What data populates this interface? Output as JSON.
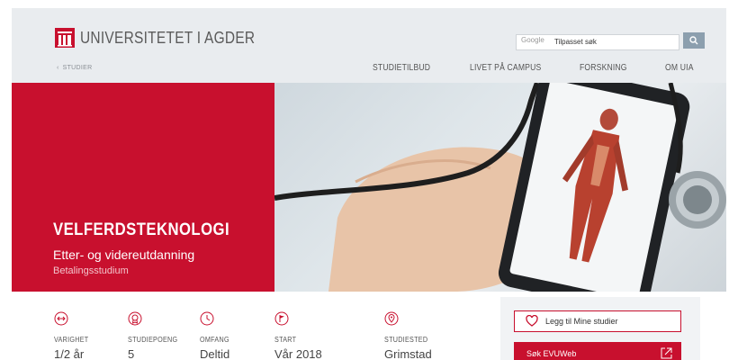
{
  "header": {
    "logo_text": "UNIVERSITETET I AGDER",
    "search": {
      "brand": "Google",
      "placeholder": "Tilpasset søk"
    },
    "breadcrumb": "STUDIER",
    "nav": [
      "STUDIETILBUD",
      "LIVET PÅ CAMPUS",
      "FORSKNING",
      "OM UIA"
    ]
  },
  "hero": {
    "title": "VELFERDSTEKNOLOGI",
    "subtitle": "Etter- og videreutdanning",
    "tag": "Betalingsstudium"
  },
  "facts": [
    {
      "label": "VARIGHET",
      "value": "1/2 år",
      "icon": "arrows-horizontal-icon"
    },
    {
      "label": "STUDIEPOENG",
      "value": "5",
      "icon": "award-icon"
    },
    {
      "label": "OMFANG",
      "value": "Deltid",
      "icon": "clock-icon"
    },
    {
      "label": "START",
      "value": "Vår 2018",
      "icon": "flag-icon"
    },
    {
      "label": "STUDIESTED",
      "value": "Grimstad",
      "icon": "location-pin-icon"
    }
  ],
  "actions": {
    "favorite": "Legg til Mine studier",
    "apply": "Søk EVUWeb"
  },
  "colors": {
    "brand_red": "#c8102e",
    "header_bg": "#e9ecef",
    "search_button": "#8c9fae"
  }
}
